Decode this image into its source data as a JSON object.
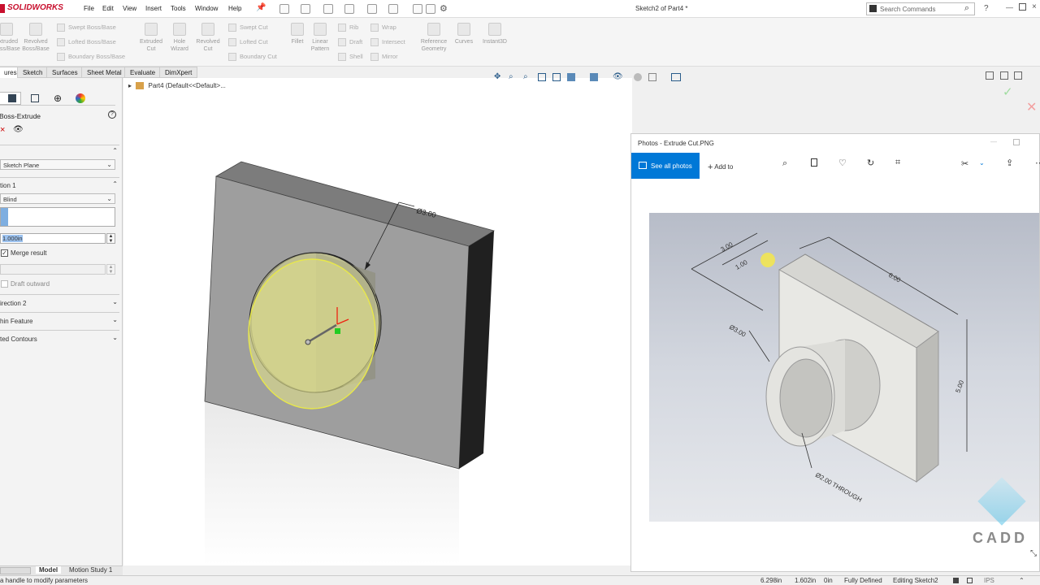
{
  "app": {
    "logo": "SOLIDWORKS",
    "doc_title": "Sketch2 of Part4 *"
  },
  "menu": [
    "File",
    "Edit",
    "View",
    "Insert",
    "Tools",
    "Window",
    "Help"
  ],
  "search": {
    "placeholder": "Search Commands"
  },
  "commands": {
    "extruded_boss": "Extruded\nBoss/Base",
    "revolved_boss": "Revolved\nBoss/Base",
    "swept_boss": "Swept Boss/Base",
    "lofted_boss": "Lofted Boss/Base",
    "boundary_boss": "Boundary Boss/Base",
    "extruded_cut": "Extruded\nCut",
    "hole_wizard": "Hole\nWizard",
    "revolved_cut": "Revolved\nCut",
    "swept_cut": "Swept Cut",
    "lofted_cut": "Lofted Cut",
    "boundary_cut": "Boundary Cut",
    "fillet": "Fillet",
    "linear_pattern": "Linear\nPattern",
    "rib": "Rib",
    "draft": "Draft",
    "shell": "Shell",
    "wrap": "Wrap",
    "intersect": "Intersect",
    "mirror": "Mirror",
    "reference_geometry": "Reference\nGeometry",
    "curves": "Curves",
    "instant3d": "Instant3D"
  },
  "tabs": [
    "ures",
    "Sketch",
    "Surfaces",
    "Sheet Metal",
    "Evaluate",
    "DimXpert"
  ],
  "feature_tree": {
    "part": "Part4  (Default<<Default>..."
  },
  "property_manager": {
    "title": "Boss-Extrude",
    "from_value": "Sketch Plane",
    "direction1_label": "tion 1",
    "end_condition": "Blind",
    "depth_value": "1.000in",
    "merge_result": "Merge result",
    "draft_outward": "Draft outward",
    "direction2": "irection 2",
    "thin_feature": "hin Feature",
    "selected_contours": "ted Contours"
  },
  "graphics": {
    "dimension": "Ø3.00"
  },
  "photos": {
    "title": "Photos - Extrude Cut.PNG",
    "see_all": "See all photos",
    "add_to": "Add to",
    "dims": {
      "d300": "3.00",
      "d100": "1.00",
      "d600": "6.00",
      "dia300": "Ø3.00",
      "d500": "5.00",
      "through": "Ø2.00 THROUGH"
    }
  },
  "watermark": "CADD",
  "bottom_tabs": [
    "Model",
    "Motion Study 1"
  ],
  "status": {
    "hint": "a handle to modify parameters",
    "x": "6.298in",
    "y": "1.602in",
    "z": "0in",
    "defined": "Fully Defined",
    "editing": "Editing Sketch2",
    "units": "IPS"
  }
}
